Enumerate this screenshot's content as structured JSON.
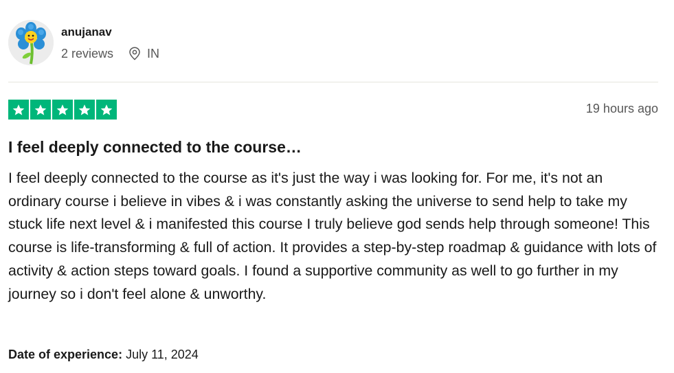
{
  "consumer": {
    "name": "anujanav",
    "reviews_count": "2 reviews",
    "country": "IN",
    "avatar_icon": "flower-avatar-icon"
  },
  "review": {
    "rating": 5,
    "max_rating": 5,
    "star_color": "#00b67a",
    "time": "19 hours ago",
    "title": "I feel deeply connected to the course…",
    "body": "I feel deeply connected to the course as it's just the way i was looking for. For me, it's not an ordinary course i believe in vibes & i was constantly asking the universe to send help to take my stuck life next level & i manifested this course I truly believe god sends help through someone! This course is life-transforming & full of action. It provides a step-by-step roadmap & guidance with lots of activity & action steps toward goals. I found a supportive community as well to go further in my journey so i don't feel alone & unworthy.",
    "experience_label": "Date of experience:",
    "experience_date": "July 11, 2024"
  }
}
